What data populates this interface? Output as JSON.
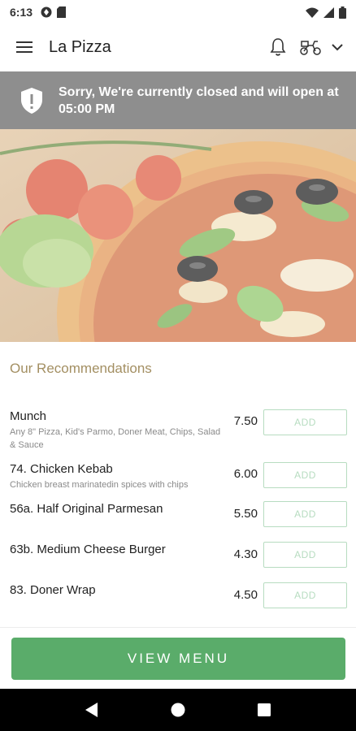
{
  "status_bar": {
    "time": "6:13"
  },
  "app_bar": {
    "title": "La Pizza"
  },
  "banner": {
    "message": "Sorry, We're currently closed and will open at 05:00 PM",
    "color": "#8e8e8e"
  },
  "recommendations": {
    "title": "Our Recommendations",
    "items": [
      {
        "name": "Munch",
        "description": "Any 8\" Pizza, Kid's Parmo, Doner Meat, Chips, Salad & Sauce",
        "price": "7.50",
        "add_label": "ADD"
      },
      {
        "name": "74. Chicken Kebab",
        "description": "Chicken breast marinatedin spices with chips",
        "price": "6.00",
        "add_label": "ADD"
      },
      {
        "name": "56a. Half Original Parmesan",
        "description": "",
        "price": "5.50",
        "add_label": "ADD"
      },
      {
        "name": "63b. Medium Cheese Burger",
        "description": "",
        "price": "4.30",
        "add_label": "ADD"
      },
      {
        "name": "83. Doner Wrap",
        "description": "",
        "price": "4.50",
        "add_label": "ADD"
      }
    ]
  },
  "footer": {
    "view_menu_label": "VIEW MENU",
    "accent": "#5aac6a"
  },
  "icons": [
    "menu-icon",
    "bell-icon",
    "delivery-scooter-icon",
    "chevron-down-icon",
    "shield-alert-icon",
    "back-icon",
    "home-icon",
    "recents-icon"
  ]
}
